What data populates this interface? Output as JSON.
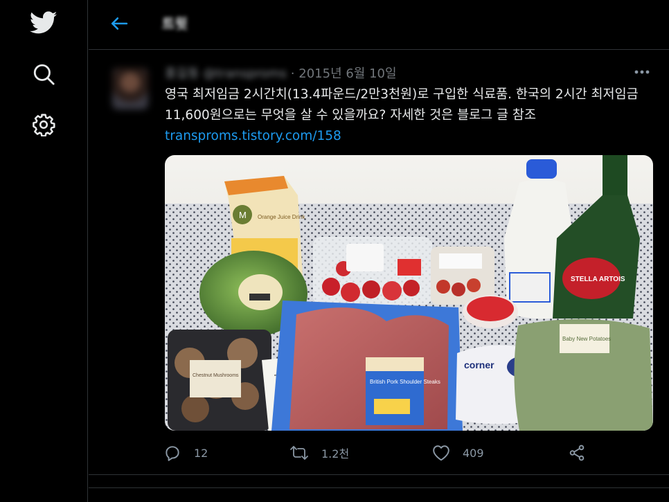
{
  "sidebar": {
    "icons": [
      "twitter-logo-icon",
      "search-icon",
      "settings-icon"
    ]
  },
  "header": {
    "title": "트윗"
  },
  "tweet": {
    "author_name": "홍길동",
    "author_handle": "@transproms",
    "separator": "·",
    "date": "2015년 6월 10일",
    "text": "영국 최저임금 2시간치(13.4파운드/2만3천원)로 구입한 식료품. 한국의 2시간 최저임금 11,600원으로는 무엇을 살 수 있을까요? 자세한 것은 블로그 글 참조",
    "link": "transproms.tistory.com/158",
    "image_alt": "Groceries on a patterned tablecloth"
  },
  "actions": {
    "reply_count": "12",
    "retweet_count": "1.2천",
    "like_count": "409"
  },
  "photo_labels": {
    "juice": "Orange Juice Drink",
    "mushroom": "Chestnut Mushrooms",
    "pork": "British Pork Shoulder Steaks",
    "corner": "corner",
    "potatoes": "Baby New Potatoes",
    "beer": "STELLA ARTOIS"
  },
  "colors": {
    "background": "#000000",
    "text": "#e7e9ea",
    "muted": "#71767b",
    "accent": "#1d9bf0",
    "border": "#2f3336"
  }
}
